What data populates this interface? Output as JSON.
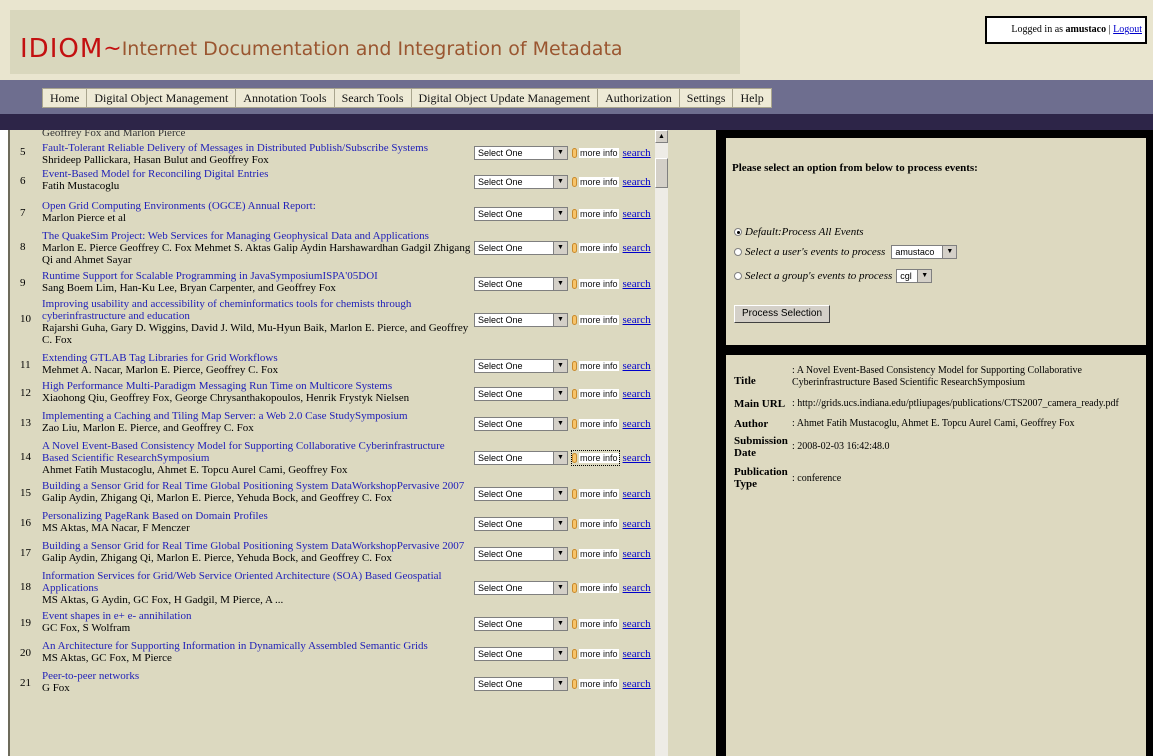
{
  "header": {
    "logo_main": "IDIOM",
    "logo_tilde": "~",
    "logo_sub": "Internet Documentation and Integration of Metadata",
    "logged_in_prefix": "Logged in as ",
    "user": "amustaco",
    "separator": " | ",
    "logout_label": "Logout"
  },
  "nav": {
    "items": [
      "Home",
      "Digital Object Management",
      "Annotation Tools",
      "Search Tools",
      "Digital Object Update Management",
      "Authorization",
      "Settings",
      "Help"
    ]
  },
  "list": {
    "cut_off_top": "Geoffrey Fox and Marlon Pierce",
    "select_value": "Select One",
    "more_info_label": "more info",
    "search_label": "search",
    "rows": [
      {
        "num": "5",
        "title": "Fault-Tolerant Reliable Delivery of Messages in Distributed Publish/Subscribe Systems",
        "authors": "Shrideep Pallickara, Hasan Bulut and Geoffrey Fox"
      },
      {
        "num": "6",
        "title": "Event-Based Model for Reconciling Digital Entries",
        "authors": "Fatih Mustacoglu"
      },
      {
        "num": "7",
        "title": "Open Grid Computing Environments (OGCE) Annual Report:",
        "authors": "Marlon Pierce et al"
      },
      {
        "num": "8",
        "title": "The QuakeSim Project: Web Services for Managing Geophysical Data and Applications",
        "authors": "Marlon E. Pierce Geoffrey C. Fox Mehmet S. Aktas Galip Aydin Harshawardhan Gadgil Zhigang Qi and Ahmet Sayar"
      },
      {
        "num": "9",
        "title": "Runtime Support for Scalable Programming in JavaSymposiumISPA'05DOI",
        "authors": "Sang Boem Lim, Han-Ku Lee, Bryan Carpenter, and Geoffrey Fox"
      },
      {
        "num": "10",
        "title": "Improving usability and accessibility of cheminformatics tools for chemists through cyberinfrastructure and education",
        "authors": "Rajarshi Guha, Gary D. Wiggins, David J. Wild, Mu-Hyun Baik, Marlon E. Pierce, and Geoffrey C. Fox"
      },
      {
        "num": "11",
        "title": "Extending GTLAB Tag Libraries for Grid Workflows",
        "authors": "Mehmet A. Nacar, Marlon E. Pierce, Geoffrey C. Fox"
      },
      {
        "num": "12",
        "title": "High Performance Multi-Paradigm Messaging Run Time on Multicore Systems",
        "authors": "Xiaohong Qiu, Geoffrey Fox, George Chrysanthakopoulos, Henrik Frystyk Nielsen"
      },
      {
        "num": "13",
        "title": "Implementing a Caching and Tiling Map Server: a Web 2.0 Case StudySymposium",
        "authors": "Zao Liu, Marlon E. Pierce, and Geoffrey C. Fox"
      },
      {
        "num": "14",
        "title": "A Novel Event-Based Consistency Model for Supporting Collaborative Cyberinfrastructure Based Scientific ResearchSymposium",
        "authors": "Ahmet Fatih Mustacoglu, Ahmet E. Topcu Aurel Cami, Geoffrey Fox"
      },
      {
        "num": "15",
        "title": "Building a Sensor Grid for Real Time Global Positioning System DataWorkshopPervasive 2007",
        "authors": "Galip Aydin, Zhigang Qi, Marlon E. Pierce, Yehuda Bock, and Geoffrey C. Fox"
      },
      {
        "num": "16",
        "title": "Personalizing PageRank Based on Domain Profiles",
        "authors": "MS Aktas, MA Nacar, F Menczer"
      },
      {
        "num": "17",
        "title": "Building a Sensor Grid for Real Time Global Positioning System DataWorkshopPervasive 2007",
        "authors": "Galip Aydin, Zhigang Qi, Marlon E. Pierce, Yehuda Bock, and Geoffrey C. Fox"
      },
      {
        "num": "18",
        "title": "Information Services for Grid/Web Service Oriented Architecture (SOA) Based Geospatial Applications",
        "authors": "MS Aktas, G Aydin, GC Fox, H Gadgil, M Pierce, A ..."
      },
      {
        "num": "19",
        "title": "Event shapes in e+ e- annihilation",
        "authors": "GC Fox, S Wolfram"
      },
      {
        "num": "20",
        "title": "An Architecture for Supporting Information in Dynamically Assembled Semantic Grids",
        "authors": "MS Aktas, GC Fox, M Pierce"
      },
      {
        "num": "21",
        "title": "Peer-to-peer networks",
        "authors": "G Fox"
      }
    ]
  },
  "events": {
    "prompt": "Please select an option from below to process events:",
    "option_all": "Default:Process All Events",
    "option_user": "Select a user's events to process",
    "user_select_value": "amustaco",
    "option_group": "Select a group's events to process",
    "group_select_value": "cgl",
    "selected_option": "all",
    "process_button": "Process Selection"
  },
  "details": {
    "title_label": "Title",
    "title_value": "A Novel Event-Based Consistency Model for Supporting Collaborative Cyberinfrastructure Based Scientific ResearchSymposium",
    "url_label": "Main URL",
    "url_value": "http://grids.ucs.indiana.edu/ptliupages/publications/CTS2007_camera_ready.pdf",
    "author_label": "Author",
    "author_value": "Ahmet Fatih Mustacoglu, Ahmet E. Topcu Aurel Cami, Geoffrey Fox",
    "date_label": "Submission Date",
    "date_value": "2008-02-03 16:42:48.0",
    "pubtype_label": "Publication Type",
    "pubtype_value": "conference"
  }
}
